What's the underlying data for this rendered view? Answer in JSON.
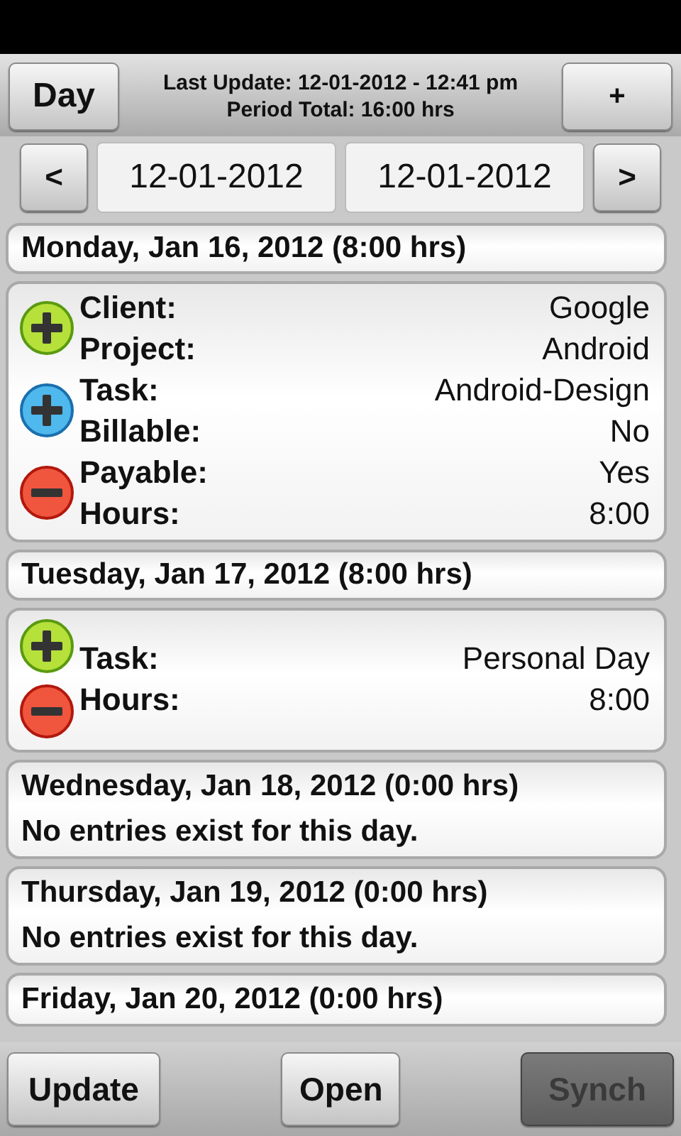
{
  "header": {
    "view_button": "Day",
    "last_update": "Last Update: 12-01-2012 - 12:41 pm",
    "period_total": "Period Total: 16:00 hrs",
    "add_button": "+"
  },
  "date_range": {
    "prev_button": "<",
    "start": "12-01-2012",
    "end": "12-01-2012",
    "next_button": ">"
  },
  "days": [
    {
      "title": "Monday, Jan 16, 2012 (8:00 hrs)",
      "entries": [
        {
          "actions": [
            {
              "kind": "add"
            },
            {
              "kind": "add_task"
            },
            {
              "kind": "delete"
            }
          ],
          "fields": [
            {
              "label": "Client:",
              "value": "Google"
            },
            {
              "label": "Project:",
              "value": "Android"
            },
            {
              "label": "Task:",
              "value": "Android-Design"
            },
            {
              "label": "Billable:",
              "value": "No"
            },
            {
              "label": "Payable:",
              "value": "Yes"
            },
            {
              "label": "Hours:",
              "value": "8:00"
            }
          ]
        }
      ]
    },
    {
      "title": "Tuesday, Jan 17, 2012 (8:00 hrs)",
      "entries": [
        {
          "actions": [
            {
              "kind": "add"
            },
            {
              "kind": "delete"
            }
          ],
          "fields": [
            {
              "label": "Task:",
              "value": "Personal Day"
            },
            {
              "label": "Hours:",
              "value": "8:00"
            }
          ]
        }
      ]
    },
    {
      "title": "Wednesday, Jan 18, 2012 (0:00 hrs)",
      "message": "No entries exist for this day."
    },
    {
      "title": "Thursday, Jan 19, 2012 (0:00 hrs)",
      "message": "No entries exist for this day."
    },
    {
      "title": "Friday, Jan 20, 2012 (0:00 hrs)"
    }
  ],
  "buttons": [
    {
      "label": "Update",
      "disabled": false
    },
    {
      "label": "Open",
      "disabled": false
    },
    {
      "label": "Synch",
      "disabled": true
    }
  ]
}
